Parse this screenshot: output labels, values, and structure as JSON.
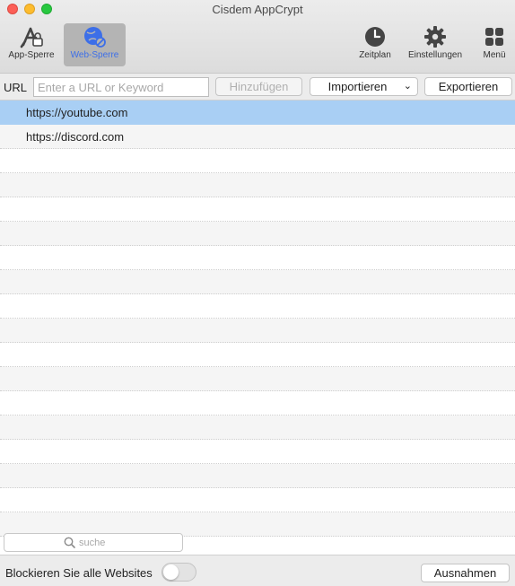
{
  "window": {
    "title": "Cisdem AppCrypt"
  },
  "toolbar": {
    "app_lock": {
      "label": "App-Sperre",
      "icon": "app-lock-icon"
    },
    "web_lock": {
      "label": "Web-Sperre",
      "icon": "web-lock-icon",
      "active": true
    },
    "schedule": {
      "label": "Zeitplan",
      "icon": "clock-icon"
    },
    "settings": {
      "label": "Einstellungen",
      "icon": "gear-icon"
    },
    "menu": {
      "label": "Menü",
      "icon": "grid-icon"
    }
  },
  "url_bar": {
    "label": "URL",
    "placeholder": "Enter a URL or Keyword",
    "value": "",
    "add_label": "Hinzufügen",
    "import_label": "Importieren",
    "export_label": "Exportieren"
  },
  "blocked_sites": [
    {
      "url": "https://youtube.com",
      "selected": true
    },
    {
      "url": "https://discord.com",
      "selected": false
    }
  ],
  "search": {
    "placeholder": "suche",
    "value": ""
  },
  "footer": {
    "block_all_label": "Blockieren Sie alle Websites",
    "block_all_on": false,
    "exceptions_label": "Ausnahmen"
  },
  "colors": {
    "selection": "#a9cff4",
    "active_tool": "#3d6fe8"
  }
}
